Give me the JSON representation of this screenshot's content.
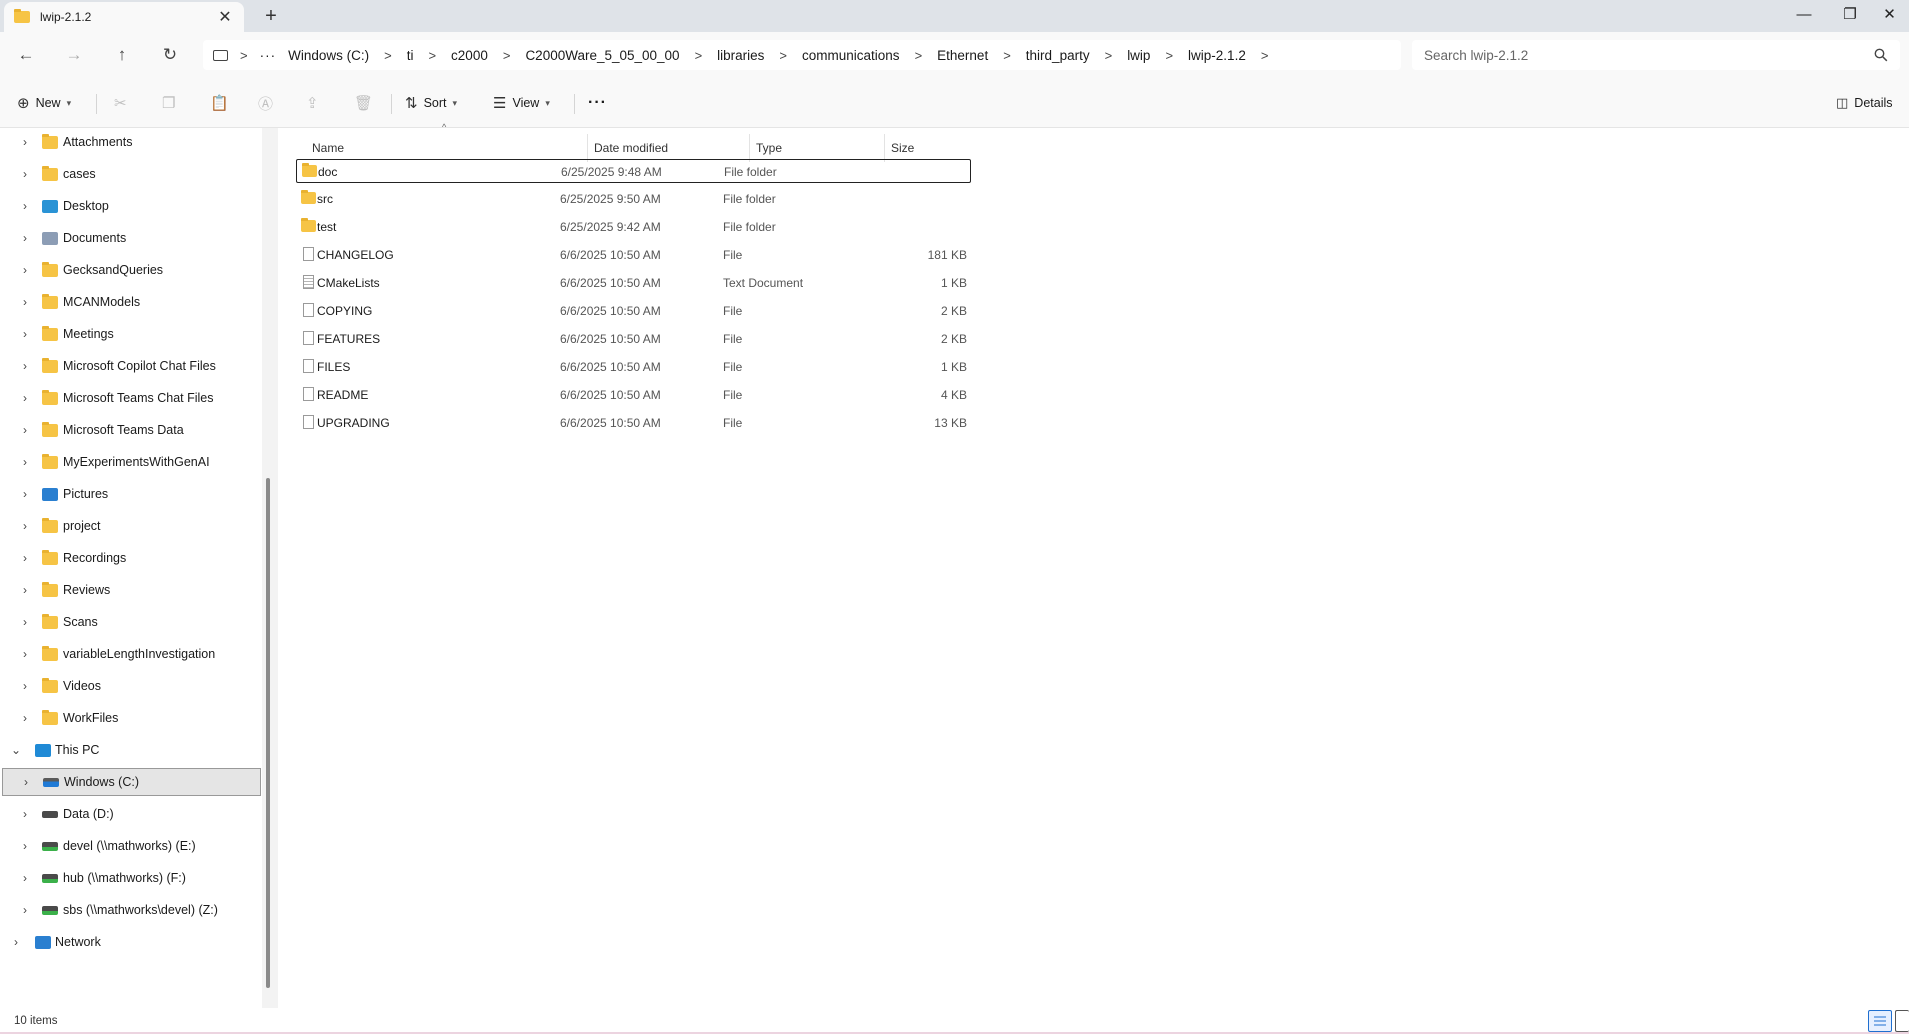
{
  "window": {
    "tab_title": "lwip-2.1.2",
    "new_tab_glyph": "+",
    "close_tab_glyph": "✕",
    "minimize_glyph": "—",
    "maximize_glyph": "❐",
    "close_glyph": "✕"
  },
  "nav": {
    "back_glyph": "←",
    "forward_glyph": "→",
    "up_glyph": "↑",
    "refresh_glyph": "↻"
  },
  "address": {
    "more_glyph": "···",
    "crumbs": [
      "Windows (C:)",
      "ti",
      "c2000",
      "C2000Ware_5_05_00_00",
      "libraries",
      "communications",
      "Ethernet",
      "third_party",
      "lwip",
      "lwip-2.1.2"
    ],
    "separator": ">"
  },
  "search": {
    "placeholder": "Search lwip-2.1.2"
  },
  "commandbar": {
    "new_label": "New",
    "sort_label": "Sort",
    "view_label": "View",
    "more_glyph": "···",
    "details_label": "Details"
  },
  "sidebar": {
    "items": [
      {
        "label": "Attachments",
        "icon": "folder-icon"
      },
      {
        "label": "cases",
        "icon": "folder-icon"
      },
      {
        "label": "Desktop",
        "icon": "desktop-icon"
      },
      {
        "label": "Documents",
        "icon": "documents-icon"
      },
      {
        "label": "GecksandQueries",
        "icon": "folder-icon"
      },
      {
        "label": "MCANModels",
        "icon": "folder-icon"
      },
      {
        "label": "Meetings",
        "icon": "folder-icon"
      },
      {
        "label": "Microsoft Copilot Chat Files",
        "icon": "folder-icon"
      },
      {
        "label": "Microsoft Teams Chat Files",
        "icon": "folder-icon"
      },
      {
        "label": "Microsoft Teams Data",
        "icon": "folder-icon"
      },
      {
        "label": "MyExperimentsWithGenAI",
        "icon": "folder-icon"
      },
      {
        "label": "Pictures",
        "icon": "pictures-icon"
      },
      {
        "label": "project",
        "icon": "folder-icon"
      },
      {
        "label": "Recordings",
        "icon": "folder-icon"
      },
      {
        "label": "Reviews",
        "icon": "folder-icon"
      },
      {
        "label": "Scans",
        "icon": "folder-icon"
      },
      {
        "label": "variableLengthInvestigation",
        "icon": "folder-icon"
      },
      {
        "label": "Videos",
        "icon": "folder-icon"
      },
      {
        "label": "WorkFiles",
        "icon": "folder-icon"
      }
    ],
    "this_pc": "This PC",
    "drives": [
      {
        "label": "Windows (C:)",
        "icon": "drive-c-icon",
        "selected": true
      },
      {
        "label": "Data (D:)",
        "icon": "drive-icon"
      },
      {
        "label": "devel (\\\\mathworks) (E:)",
        "icon": "network-drive-icon"
      },
      {
        "label": "hub (\\\\mathworks) (F:)",
        "icon": "network-drive-icon"
      },
      {
        "label": "sbs (\\\\mathworks\\devel) (Z:)",
        "icon": "network-drive-icon"
      }
    ],
    "network": "Network"
  },
  "table": {
    "headers": {
      "name": "Name",
      "date": "Date modified",
      "type": "Type",
      "size": "Size"
    },
    "rows": [
      {
        "name": "doc",
        "date": "6/25/2025 9:48 AM",
        "type": "File folder",
        "size": "",
        "kind": "folder"
      },
      {
        "name": "src",
        "date": "6/25/2025 9:50 AM",
        "type": "File folder",
        "size": "",
        "kind": "folder"
      },
      {
        "name": "test",
        "date": "6/25/2025 9:42 AM",
        "type": "File folder",
        "size": "",
        "kind": "folder"
      },
      {
        "name": "CHANGELOG",
        "date": "6/6/2025 10:50 AM",
        "type": "File",
        "size": "181 KB",
        "kind": "file"
      },
      {
        "name": "CMakeLists",
        "date": "6/6/2025 10:50 AM",
        "type": "Text Document",
        "size": "1 KB",
        "kind": "text"
      },
      {
        "name": "COPYING",
        "date": "6/6/2025 10:50 AM",
        "type": "File",
        "size": "2 KB",
        "kind": "file"
      },
      {
        "name": "FEATURES",
        "date": "6/6/2025 10:50 AM",
        "type": "File",
        "size": "2 KB",
        "kind": "file"
      },
      {
        "name": "FILES",
        "date": "6/6/2025 10:50 AM",
        "type": "File",
        "size": "1 KB",
        "kind": "file"
      },
      {
        "name": "README",
        "date": "6/6/2025 10:50 AM",
        "type": "File",
        "size": "4 KB",
        "kind": "file"
      },
      {
        "name": "UPGRADING",
        "date": "6/6/2025 10:50 AM",
        "type": "File",
        "size": "13 KB",
        "kind": "file"
      }
    ]
  },
  "status": {
    "count": "10 items"
  },
  "colors": {
    "accent": "#1f6fd0",
    "folder": "#f6c445",
    "selection": "#e5e5e5"
  }
}
